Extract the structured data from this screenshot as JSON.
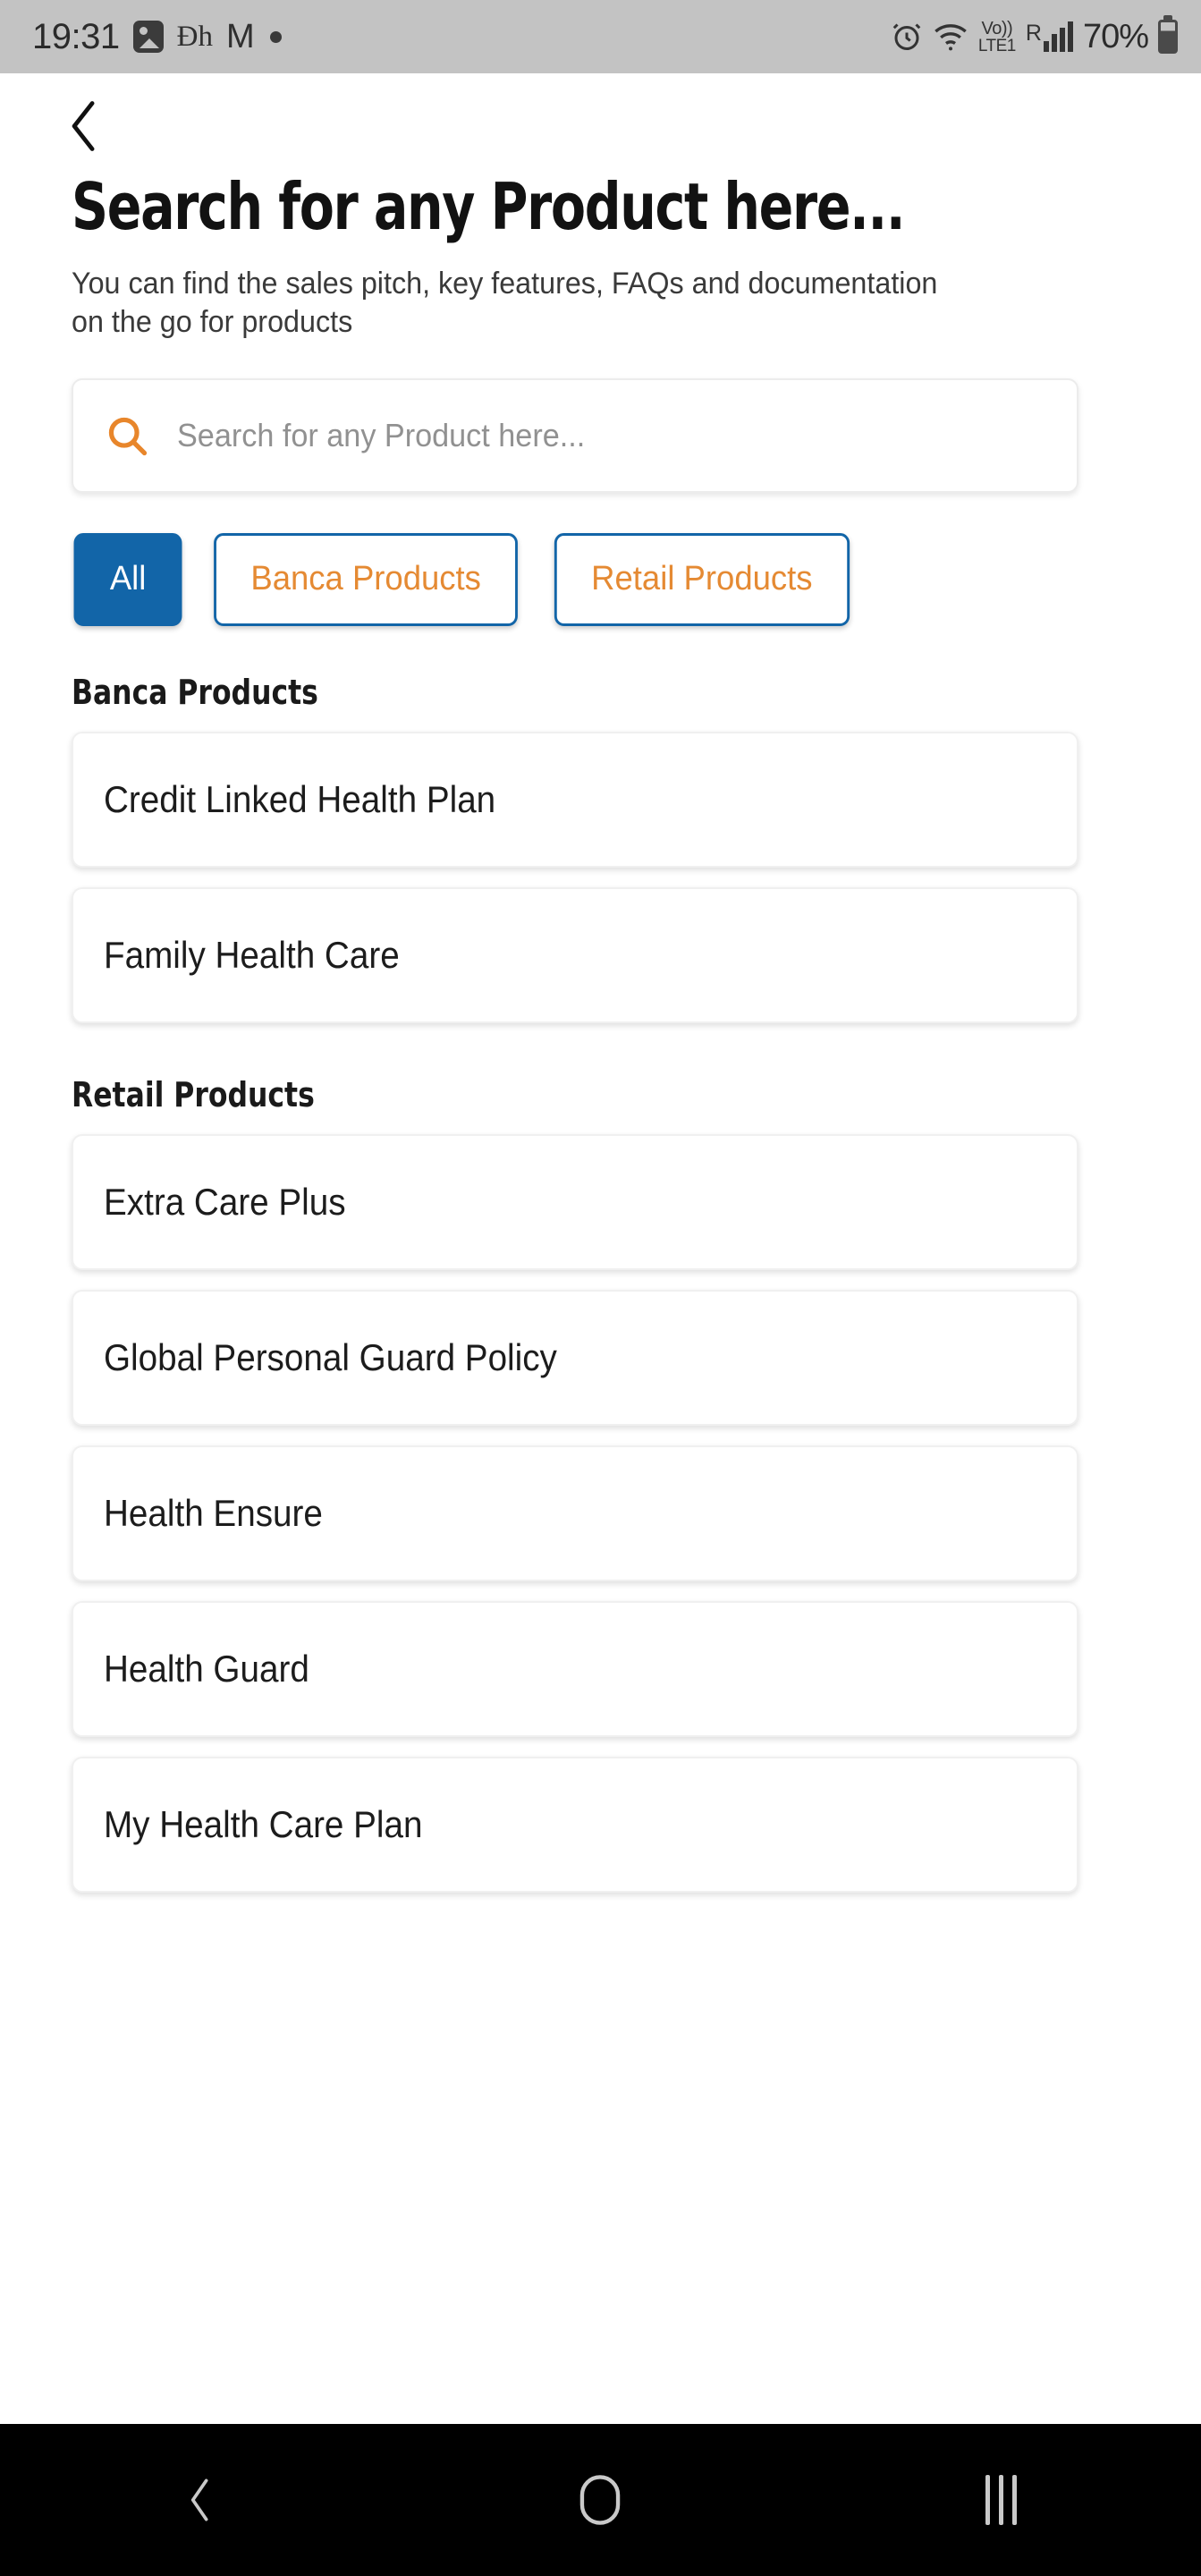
{
  "status_bar": {
    "time": "19:31",
    "left_icons": [
      "photo-icon",
      "disney-plus-icon",
      "gmail-icon",
      "dot-indicator-icon"
    ],
    "disney_glyph": "Ðh",
    "gmail_glyph": "M",
    "alarm_icon": "alarm-icon",
    "wifi_icon": "wifi-icon",
    "volte_top": "Vo))",
    "volte_bottom": "LTE1",
    "roaming": "R",
    "signal_icon": "signal-bars-icon",
    "battery_percent": "70%",
    "battery_icon": "battery-icon"
  },
  "header": {
    "back_icon": "back-chevron-icon",
    "title": "Search for any Product here...",
    "subtitle": "You can find the sales pitch, key features, FAQs and documentation on the go for products"
  },
  "search": {
    "icon": "search-icon",
    "value": "",
    "placeholder": "Search for any Product here..."
  },
  "filters": [
    {
      "label": "All",
      "active": true
    },
    {
      "label": "Banca Products",
      "active": false
    },
    {
      "label": "Retail Products",
      "active": false
    }
  ],
  "sections": [
    {
      "title": "Banca Products",
      "items": [
        {
          "label": "Credit Linked Health Plan"
        },
        {
          "label": "Family Health Care"
        }
      ]
    },
    {
      "title": "Retail Products",
      "items": [
        {
          "label": "Extra Care Plus"
        },
        {
          "label": "Global Personal Guard Policy"
        },
        {
          "label": "Health Ensure"
        },
        {
          "label": "Health Guard"
        },
        {
          "label": "My Health Care Plan"
        }
      ]
    }
  ],
  "nav_bar": {
    "back": "nav-back-icon",
    "home": "nav-home-icon",
    "recents": "nav-recents-icon"
  },
  "colors": {
    "accent_blue": "#1265A8",
    "accent_orange": "#E58A33",
    "status_bar_bg": "#c3c3c3",
    "nav_bar_bg": "#000000",
    "text_primary": "#1c1c1c",
    "placeholder": "#919191"
  }
}
